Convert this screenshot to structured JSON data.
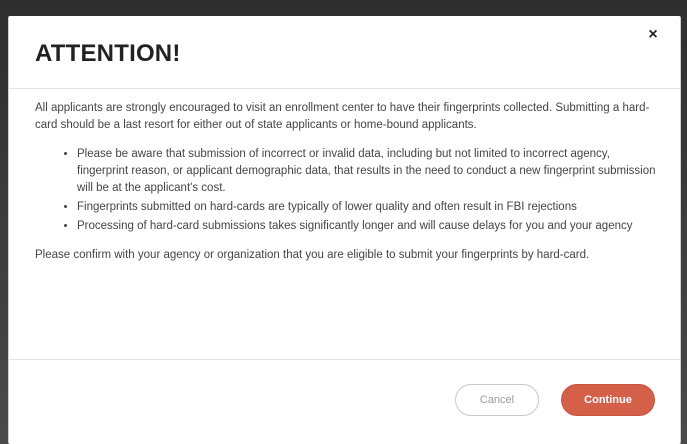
{
  "modal": {
    "title": "ATTENTION!",
    "close_label": "×",
    "intro": "All applicants are strongly encouraged to visit an enrollment center to have their fingerprints collected. Submitting a hard-card should be a last resort for either out of state applicants or home-bound applicants.",
    "bullets": [
      "Please be aware that submission of incorrect or invalid data, including but not limited to incorrect agency, fingerprint reason, or applicant demographic data, that results in the need to conduct a new fingerprint submission will be at the applicant's cost.",
      "Fingerprints submitted on hard-cards are typically of lower quality and often result in FBI rejections",
      "Processing of hard-card submissions takes significantly longer and will cause delays for you and your agency"
    ],
    "outro": "Please confirm with your agency or organization that you are eligible to submit your fingerprints by hard-card.",
    "cancel_label": "Cancel",
    "continue_label": "Continue"
  },
  "colors": {
    "accent": "#d5604a",
    "text": "#444444",
    "title": "#222222"
  },
  "icons": {
    "close": "close-icon"
  }
}
